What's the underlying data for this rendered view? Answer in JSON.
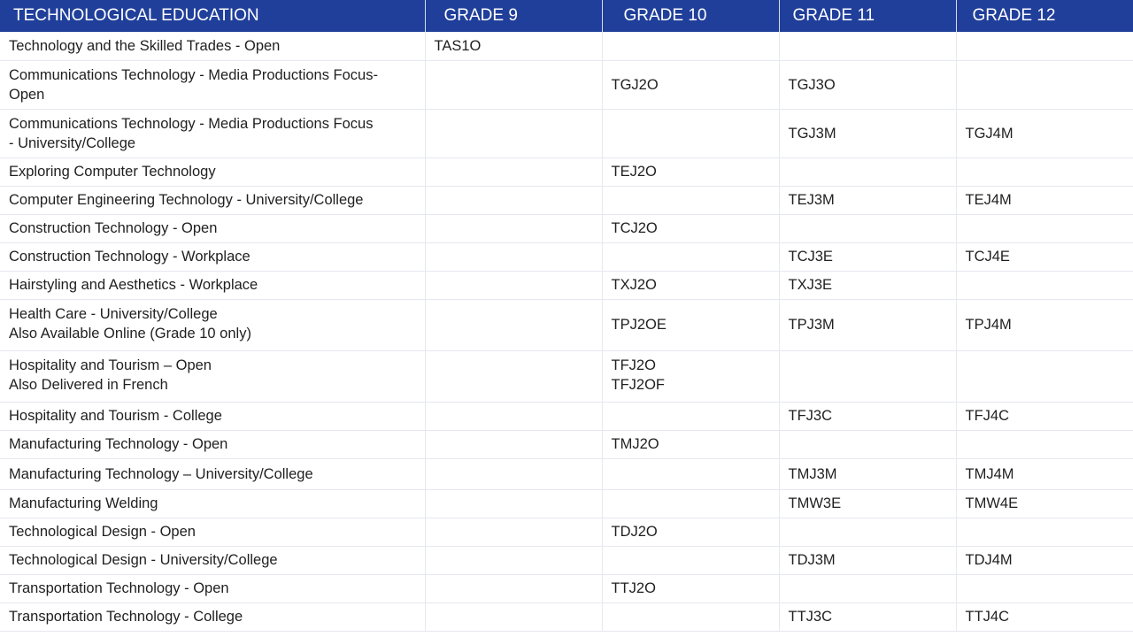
{
  "table": {
    "headers": [
      "TECHNOLOGICAL EDUCATION",
      "GRADE 9",
      "GRADE 10",
      "GRADE 11",
      "GRADE 12"
    ],
    "rows": [
      {
        "title": "Technology and the Skilled Trades - Open",
        "g9": "TAS1O",
        "g10": "",
        "g11": "",
        "g12": ""
      },
      {
        "title": "Communications Technology - Media Productions Focus-\nOpen",
        "g9": "",
        "g10": "TGJ2O",
        "g11": "TGJ3O",
        "g12": ""
      },
      {
        "title": "Communications Technology - Media Productions Focus\n- University/College",
        "g9": "",
        "g10": "",
        "g11": "TGJ3M",
        "g12": "TGJ4M"
      },
      {
        "title": "Exploring Computer Technology",
        "g9": "",
        "g10": "TEJ2O",
        "g11": "",
        "g12": ""
      },
      {
        "title": "Computer Engineering Technology - University/College",
        "g9": "",
        "g10": "",
        "g11": "TEJ3M",
        "g12": "TEJ4M"
      },
      {
        "title": "Construction Technology - Open",
        "g9": "",
        "g10": "TCJ2O",
        "g11": "",
        "g12": ""
      },
      {
        "title": "Construction Technology - Workplace",
        "g9": "",
        "g10": "",
        "g11": "TCJ3E",
        "g12": "TCJ4E"
      },
      {
        "title": "Hairstyling and Aesthetics - Workplace",
        "g9": "",
        "g10": "TXJ2O",
        "g11": "TXJ3E",
        "g12": ""
      },
      {
        "title": "Health Care - University/College\nAlso Available Online (Grade 10 only)",
        "g9": "",
        "g10": "TPJ2OE",
        "g11": "TPJ3M",
        "g12": "TPJ4M"
      },
      {
        "title": "Hospitality and Tourism – Open\nAlso Delivered in French",
        "g9": "",
        "g10": "TFJ2O\nTFJ2OF",
        "g11": "",
        "g12": ""
      },
      {
        "title": "Hospitality and Tourism - College",
        "g9": "",
        "g10": "",
        "g11": "TFJ3C",
        "g12": "TFJ4C"
      },
      {
        "title": "Manufacturing Technology - Open",
        "g9": "",
        "g10": "TMJ2O",
        "g11": "",
        "g12": ""
      },
      {
        "title": "Manufacturing Technology – University/College",
        "g9": "",
        "g10": "",
        "g11": "TMJ3M",
        "g12": "TMJ4M"
      },
      {
        "title": "Manufacturing Welding",
        "g9": "",
        "g10": "",
        "g11": "TMW3E",
        "g12": "TMW4E"
      },
      {
        "title": "Technological Design - Open",
        "g9": "",
        "g10": "TDJ2O",
        "g11": "",
        "g12": ""
      },
      {
        "title": "Technological Design - University/College",
        "g9": "",
        "g10": "",
        "g11": "TDJ3M",
        "g12": "TDJ4M"
      },
      {
        "title": "Transportation Technology - Open",
        "g9": "",
        "g10": "TTJ2O",
        "g11": "",
        "g12": ""
      },
      {
        "title": "Transportation Technology - College",
        "g9": "",
        "g10": "",
        "g11": "TTJ3C",
        "g12": "TTJ4C"
      }
    ]
  },
  "colors": {
    "header_bg": "#203f9a",
    "header_text": "#ffffff",
    "grid_line": "#e6e8ef"
  }
}
